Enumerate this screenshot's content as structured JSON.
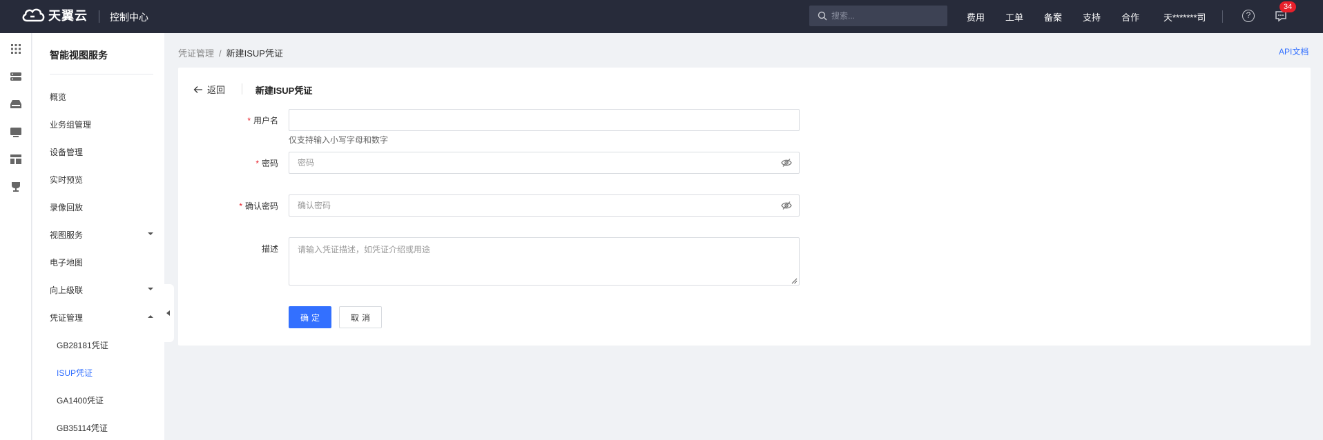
{
  "topbar": {
    "brand": "天翼云",
    "console_title": "控制中心",
    "search_placeholder": "搜索...",
    "links": [
      "费用",
      "工单",
      "备案",
      "支持",
      "合作"
    ],
    "username": "天*******司",
    "help_glyph": "?",
    "message_count": "34"
  },
  "rail_icons": [
    "grid-icon",
    "server-icon",
    "storage-icon",
    "monitor-icon",
    "layout-icon",
    "trophy-icon"
  ],
  "sidebar": {
    "title": "智能视图服务",
    "items": [
      {
        "label": "概览"
      },
      {
        "label": "业务组管理"
      },
      {
        "label": "设备管理"
      },
      {
        "label": "实时预览"
      },
      {
        "label": "录像回放"
      },
      {
        "label": "视图服务",
        "expandable": "collapsed"
      },
      {
        "label": "电子地图"
      },
      {
        "label": "向上级联",
        "expandable": "collapsed"
      },
      {
        "label": "凭证管理",
        "expandable": "expanded"
      },
      {
        "label": "GB28181凭证",
        "sub": true
      },
      {
        "label": "ISUP凭证",
        "sub": true,
        "active": true
      },
      {
        "label": "GA1400凭证",
        "sub": true
      },
      {
        "label": "GB35114凭证",
        "sub": true
      }
    ]
  },
  "breadcrumb": {
    "parent": "凭证管理",
    "separator": "/",
    "current": "新建ISUP凭证"
  },
  "api_doc": "API文档",
  "form": {
    "back_label": "返回",
    "title": "新建ISUP凭证",
    "required_mark": "*",
    "username": {
      "label": "用户名",
      "value": "",
      "placeholder": "",
      "hint": "仅支持输入小写字母和数字"
    },
    "password": {
      "label": "密码",
      "placeholder": "密码"
    },
    "confirm_password": {
      "label": "确认密码",
      "placeholder": "确认密码"
    },
    "description": {
      "label": "描述",
      "placeholder": "请输入凭证描述，如凭证介绍或用途"
    },
    "submit_label": "确定",
    "cancel_label": "取消"
  },
  "colors": {
    "topbar": "#272b3a",
    "accent": "#3370ff",
    "required": "#e8202b",
    "badge": "#e8202b"
  }
}
